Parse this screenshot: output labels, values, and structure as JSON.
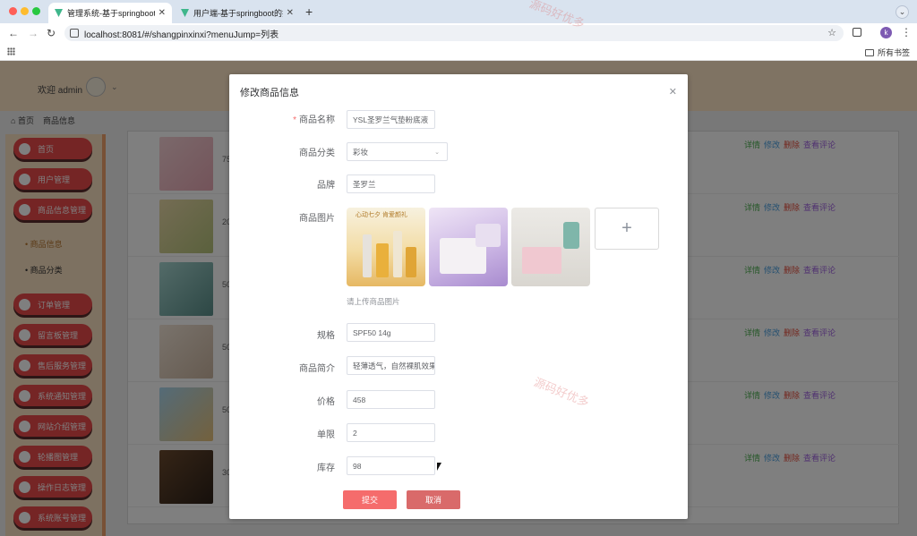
{
  "browser": {
    "tabs": [
      {
        "title": "管理系统-基于springboot的护肤"
      },
      {
        "title": "用户端-基于springboot的护肤"
      }
    ],
    "url": "localhost:8081/#/shangpinxinxi?menuJump=列表",
    "bookmarks_folder": "所有书签",
    "profile_initial": "k"
  },
  "app": {
    "welcome": "欢迎 admin",
    "breadcrumb": [
      "首页",
      "商品信息"
    ],
    "sidebar": [
      {
        "label": "首页"
      },
      {
        "label": "用户管理"
      },
      {
        "label": "商品信息管理"
      }
    ],
    "sidebar_sub": [
      {
        "label": "商品信息",
        "active": true
      },
      {
        "label": "商品分类",
        "active": false
      }
    ],
    "sidebar_more": [
      {
        "label": "订单管理"
      },
      {
        "label": "留言板管理"
      },
      {
        "label": "售后服务管理"
      },
      {
        "label": "系统通知管理"
      },
      {
        "label": "网站介绍管理"
      },
      {
        "label": "轮播图管理"
      },
      {
        "label": "操作日志管理"
      },
      {
        "label": "系统账号管理"
      }
    ],
    "row_numbers": [
      "75",
      "20",
      "50",
      "50",
      "50",
      "30"
    ],
    "actions": {
      "detail": "详情",
      "edit": "修改",
      "delete": "删除",
      "review": "查看评论"
    }
  },
  "dialog": {
    "title": "修改商品信息",
    "fields": {
      "name_label": "商品名称",
      "name_value": "YSL圣罗兰气垫粉底液",
      "category_label": "商品分类",
      "category_value": "彩妆",
      "brand_label": "品牌",
      "brand_value": "圣罗兰",
      "images_label": "商品图片",
      "images_tip": "请上传商品图片",
      "image1_caption": "心动七夕 肯爱颜礼",
      "spec_label": "规格",
      "spec_value": "SPF50 14g",
      "intro_label": "商品简介",
      "intro_value": "轻薄透气，自然裸肌效果",
      "price_label": "价格",
      "price_value": "458",
      "limit_label": "单限",
      "limit_value": "2",
      "stock_label": "库存",
      "stock_value": "98"
    },
    "submit": "提交",
    "cancel": "取消"
  },
  "watermark": "源码好优多",
  "colors": {
    "primary": "#f56c6c",
    "sidebar_item": "#ea4a4a",
    "header_bg": "#ffe6c7"
  }
}
